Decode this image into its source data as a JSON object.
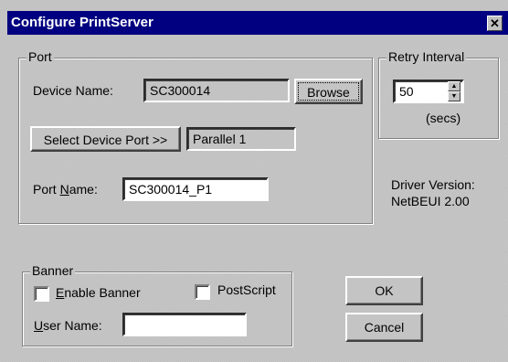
{
  "window": {
    "title": "Configure PrintServer",
    "close_glyph": "✕"
  },
  "port": {
    "legend": "Port",
    "device_name_label": "Device Name:",
    "device_name_value": "SC300014",
    "browse_label": "Browse",
    "select_port_label": "Select Device Port >>",
    "device_port_value": "Parallel 1",
    "port_name_label_pre": "Port ",
    "port_name_label_u": "N",
    "port_name_label_post": "ame:",
    "port_name_value": "SC300014_P1"
  },
  "retry": {
    "legend": "Retry Interval",
    "value": "50",
    "units": "(secs)"
  },
  "driver": {
    "label": "Driver Version:",
    "value": "NetBEUI  2.00"
  },
  "banner": {
    "legend": "Banner",
    "enable_u": "E",
    "enable_post": "nable Banner",
    "enable_checked": false,
    "postscript_label": "PostScript",
    "postscript_checked": false,
    "user_name_u": "U",
    "user_name_post": "ser Name:",
    "user_name_value": ""
  },
  "buttons": {
    "ok": "OK",
    "cancel": "Cancel"
  }
}
